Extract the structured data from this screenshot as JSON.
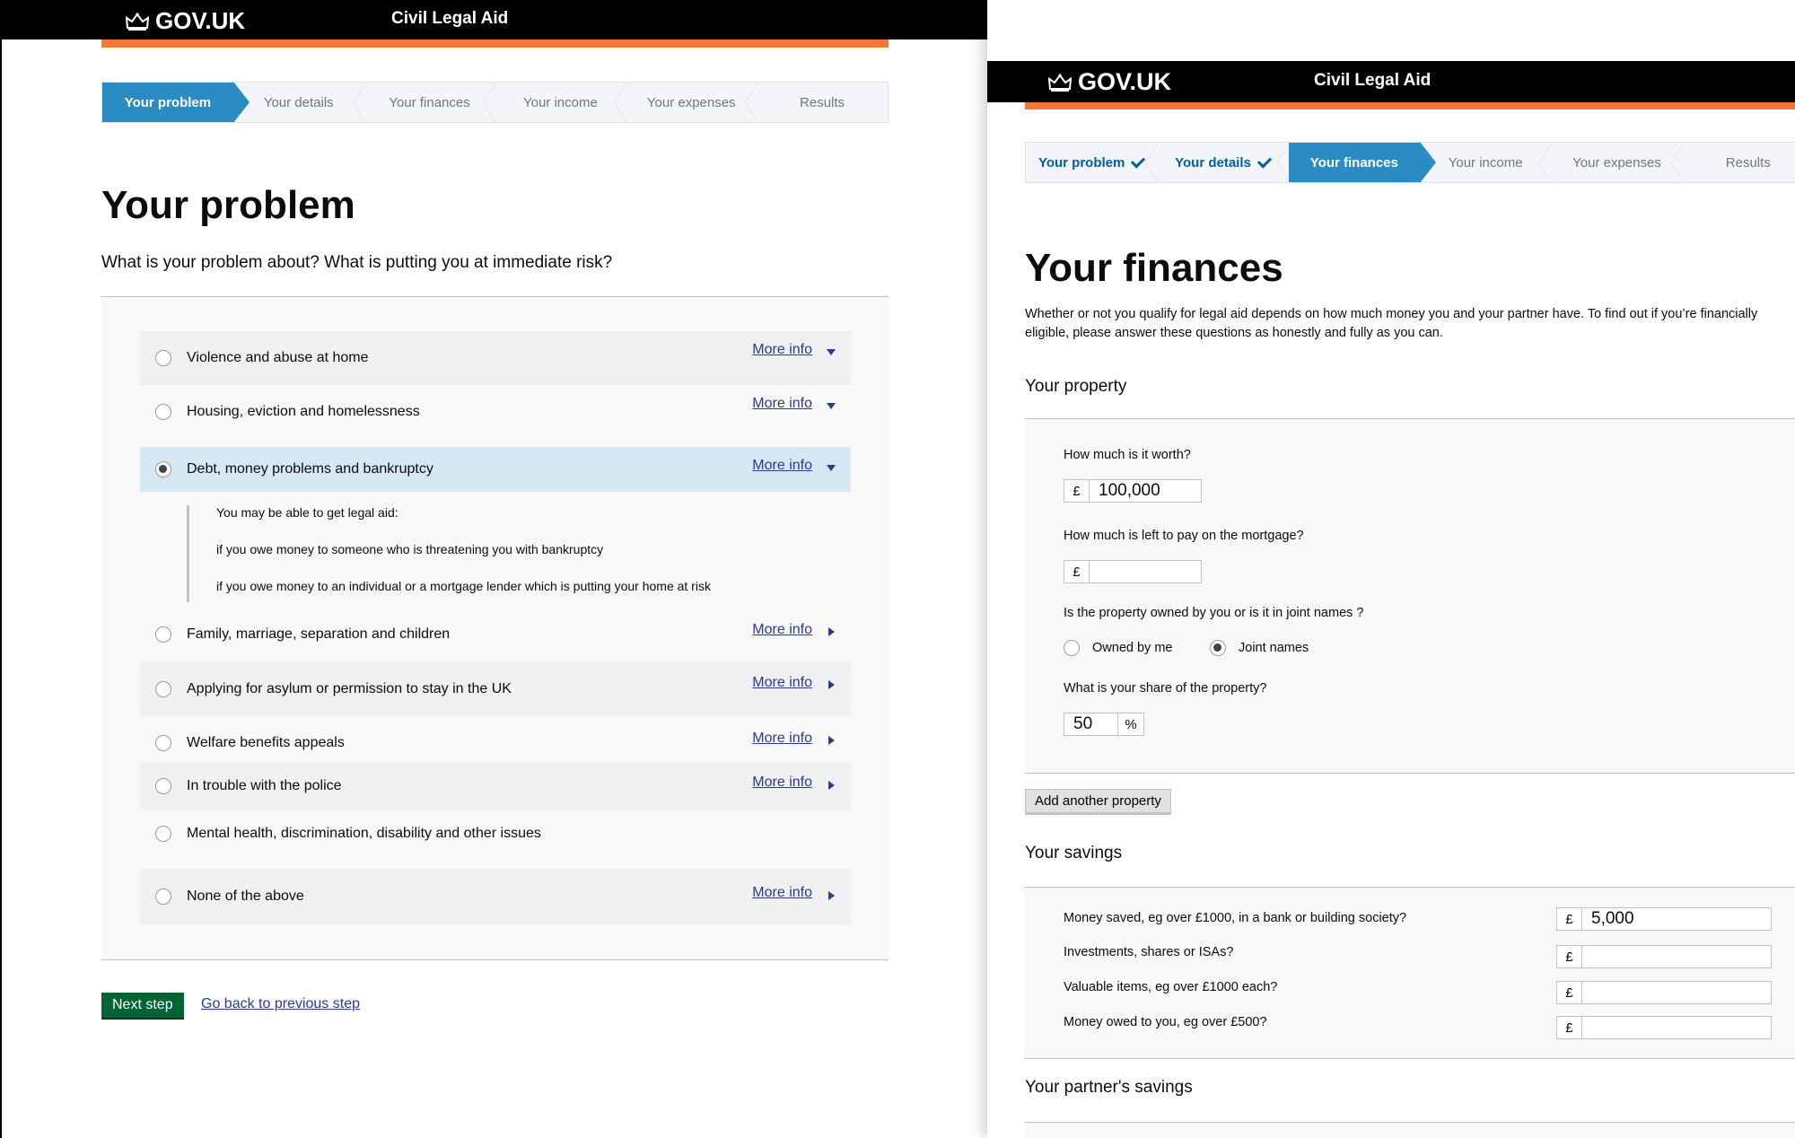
{
  "left": {
    "header": {
      "logo": "GOV.UK",
      "service": "Civil Legal Aid"
    },
    "steps": [
      "Your problem",
      "Your details",
      "Your finances",
      "Your income",
      "Your expenses",
      "Results"
    ],
    "title": "Your problem",
    "question": "What is your problem about? What is putting you at immediate risk?",
    "options": [
      {
        "label": "Violence and abuse at home",
        "more": "More info"
      },
      {
        "label": "Housing, eviction and homelessness",
        "more": "More info"
      },
      {
        "label": "Debt, money problems and bankruptcy",
        "more": "More info"
      },
      {
        "label": "Family, marriage, separation and children",
        "more": "More info"
      },
      {
        "label": "Applying for asylum or permission to stay in the UK",
        "more": "More info"
      },
      {
        "label": "Welfare benefits appeals",
        "more": "More info"
      },
      {
        "label": "In  trouble with the police",
        "more": "More info"
      },
      {
        "label": "Mental health, discrimination, disability and other issues",
        "more": ""
      },
      {
        "label": "None of the above",
        "more": "More info"
      }
    ],
    "selected_option": "Debt, money problems and bankruptcy",
    "info": [
      "You may be able to get legal aid:",
      "if you owe money to someone who is threatening you with bankruptcy",
      "if you owe money to an individual or a mortgage lender which is putting your home at risk"
    ],
    "next_button": "Next step",
    "back_link": "Go back to previous step"
  },
  "right": {
    "header": {
      "logo": "GOV.UK",
      "service": "Civil Legal Aid"
    },
    "steps": [
      "Your problem",
      "Your details",
      "Your finances",
      "Your income",
      "Your expenses",
      "Results"
    ],
    "title": "Your finances",
    "intro": "Whether or not you qualify for legal aid depends on how much money you and your partner have. To find out if you’re financially eligible, please answer these questions as honestly and fully as you can.",
    "property": {
      "heading": "Your property",
      "q_worth": "How much is it worth?",
      "worth_value": "100,000",
      "q_mortgage": "How much is left to pay on the mortgage?",
      "mortgage_value": "",
      "q_owned": "Is the property owned by you or is it in joint names ?",
      "owned_by_me": "Owned by me",
      "joint_names": "Joint names",
      "selected_ownership": "Joint names",
      "q_share": "What is your share of the property?",
      "share_value": "50",
      "currency": "£",
      "percent": "%"
    },
    "add_property": "Add another property",
    "savings": {
      "heading": "Your savings",
      "items": [
        {
          "label": "Money saved, eg over £1000, in a bank or building society?",
          "value": "5,000"
        },
        {
          "label": "Investments, shares or ISAs?",
          "value": ""
        },
        {
          "label": "Valuable items, eg over £1000 each?",
          "value": ""
        },
        {
          "label": "Money owed to you, eg over £500?",
          "value": ""
        }
      ]
    },
    "partner_savings_heading": "Your partner's savings"
  },
  "colors": {
    "header": "#000000",
    "accent_orange": "#f47738",
    "active_step": "#2b8cc4",
    "button_green": "#006435",
    "link": "#2b3a8f"
  },
  "icons": [
    "crown-icon",
    "tick-icon",
    "chevron-down-icon",
    "chevron-right-icon"
  ]
}
